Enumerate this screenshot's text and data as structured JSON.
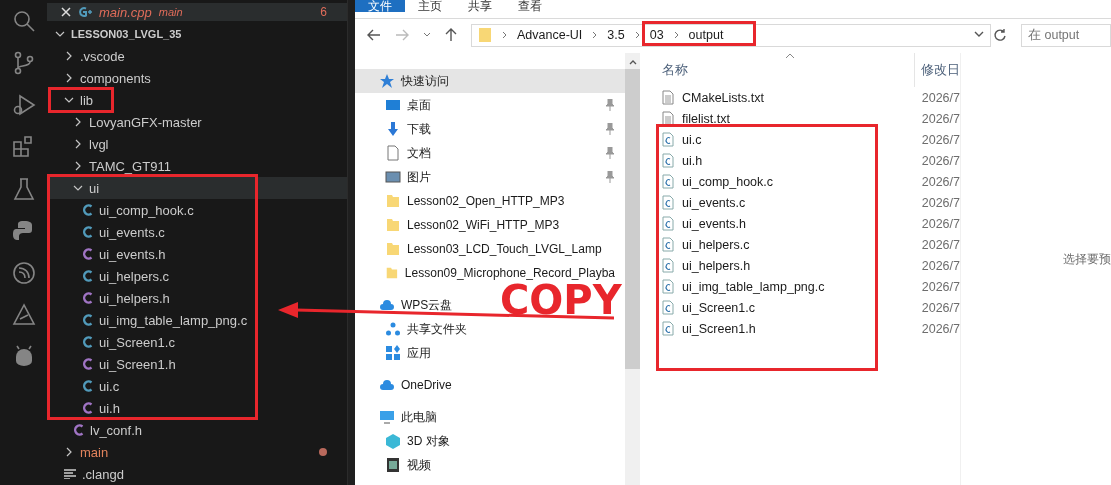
{
  "editor": {
    "open_editor": {
      "name": "main.cpp",
      "folder": "main",
      "problems": "6"
    },
    "tree": {
      "name": "LESSON03_LVGL_35",
      "expanded": true,
      "children": [
        {
          "name": ".vscode",
          "kind": "folder",
          "expanded": false,
          "selected": false,
          "modified": false
        },
        {
          "name": "components",
          "kind": "folder",
          "expanded": false,
          "selected": false,
          "modified": false
        },
        {
          "name": "lib",
          "kind": "folder",
          "expanded": true,
          "selected": false,
          "modified": false,
          "children": [
            {
              "name": "LovyanGFX-master",
              "kind": "folder",
              "expanded": false,
              "selected": false,
              "modified": false
            },
            {
              "name": "lvgl",
              "kind": "folder",
              "expanded": false,
              "selected": false,
              "modified": false
            },
            {
              "name": "TAMC_GT911",
              "kind": "folder",
              "expanded": false,
              "selected": false,
              "modified": false
            },
            {
              "name": "ui",
              "kind": "folder",
              "expanded": true,
              "selected": true,
              "modified": false,
              "children": [
                {
                  "name": "ui_comp_hook.c",
                  "kind": "c",
                  "selected": false,
                  "modified": false
                },
                {
                  "name": "ui_events.c",
                  "kind": "c",
                  "selected": false,
                  "modified": false
                },
                {
                  "name": "ui_events.h",
                  "kind": "h",
                  "selected": false,
                  "modified": false
                },
                {
                  "name": "ui_helpers.c",
                  "kind": "c",
                  "selected": false,
                  "modified": false
                },
                {
                  "name": "ui_helpers.h",
                  "kind": "h",
                  "selected": false,
                  "modified": false
                },
                {
                  "name": "ui_img_table_lamp_png.c",
                  "kind": "c",
                  "selected": false,
                  "modified": false
                },
                {
                  "name": "ui_Screen1.c",
                  "kind": "c",
                  "selected": false,
                  "modified": false
                },
                {
                  "name": "ui_Screen1.h",
                  "kind": "h",
                  "selected": false,
                  "modified": false
                },
                {
                  "name": "ui.c",
                  "kind": "c",
                  "selected": false,
                  "modified": false
                },
                {
                  "name": "ui.h",
                  "kind": "h",
                  "selected": false,
                  "modified": false
                }
              ]
            },
            {
              "name": "lv_conf.h",
              "kind": "h",
              "selected": false,
              "modified": false
            }
          ]
        },
        {
          "name": "main",
          "kind": "folder",
          "expanded": false,
          "selected": false,
          "modified": true
        },
        {
          "name": ".clangd",
          "kind": "config",
          "selected": false,
          "modified": false
        }
      ]
    }
  },
  "file_explorer": {
    "ribbon_tabs": [
      {
        "label": "文件",
        "selected": true
      },
      {
        "label": "主页",
        "selected": false
      },
      {
        "label": "共享",
        "selected": false
      },
      {
        "label": "查看",
        "selected": false
      }
    ],
    "breadcrumb": [
      "Advance-UI",
      "3.5",
      "03",
      "output"
    ],
    "search": {
      "placeholder": "在 output"
    },
    "nav": [
      {
        "name": "快速访问",
        "kind": "quick-access",
        "selected": true,
        "children": [
          {
            "name": "桌面",
            "kind": "desktop",
            "pinned": true
          },
          {
            "name": "下载",
            "kind": "downloads",
            "pinned": true
          },
          {
            "name": "文档",
            "kind": "documents",
            "pinned": true
          },
          {
            "name": "图片",
            "kind": "pictures",
            "pinned": true
          },
          {
            "name": "Lesson02_Open_HTTP_MP3",
            "kind": "folder",
            "pinned": false
          },
          {
            "name": "Lesson02_WiFi_HTTP_MP3",
            "kind": "folder",
            "pinned": false
          },
          {
            "name": "Lesson03_LCD_Touch_LVGL_Lamp",
            "kind": "folder",
            "pinned": false
          },
          {
            "name": "Lesson09_Microphone_Record_Playba",
            "kind": "folder",
            "pinned": false
          }
        ]
      },
      {
        "name": "WPS云盘",
        "kind": "cloud",
        "selected": false,
        "children": [
          {
            "name": "共享文件夹",
            "kind": "share",
            "pinned": false
          },
          {
            "name": "应用",
            "kind": "apps",
            "pinned": false
          }
        ]
      },
      {
        "name": "OneDrive",
        "kind": "onedrive",
        "selected": false
      },
      {
        "name": "此电脑",
        "kind": "pc",
        "selected": false,
        "children": [
          {
            "name": "3D 对象",
            "kind": "cube",
            "pinned": false
          },
          {
            "name": "视频",
            "kind": "video",
            "pinned": false
          }
        ]
      }
    ],
    "columns": [
      "名称",
      "修改日"
    ],
    "files": [
      {
        "name": "CMakeLists.txt",
        "kind": "text",
        "date": "2026/7"
      },
      {
        "name": "filelist.txt",
        "kind": "text",
        "date": "2026/7"
      },
      {
        "name": "ui.c",
        "kind": "c",
        "date": "2026/7"
      },
      {
        "name": "ui.h",
        "kind": "c",
        "date": "2026/7"
      },
      {
        "name": "ui_comp_hook.c",
        "kind": "c",
        "date": "2026/7"
      },
      {
        "name": "ui_events.c",
        "kind": "c",
        "date": "2026/7"
      },
      {
        "name": "ui_events.h",
        "kind": "c",
        "date": "2026/7"
      },
      {
        "name": "ui_helpers.c",
        "kind": "c",
        "date": "2026/7"
      },
      {
        "name": "ui_helpers.h",
        "kind": "c",
        "date": "2026/7"
      },
      {
        "name": "ui_img_table_lamp_png.c",
        "kind": "c",
        "date": "2026/7"
      },
      {
        "name": "ui_Screen1.c",
        "kind": "c",
        "date": "2026/7"
      },
      {
        "name": "ui_Screen1.h",
        "kind": "c",
        "date": "2026/7"
      }
    ],
    "preview_message": "选择要预"
  },
  "annotation": {
    "label": "COPY"
  }
}
